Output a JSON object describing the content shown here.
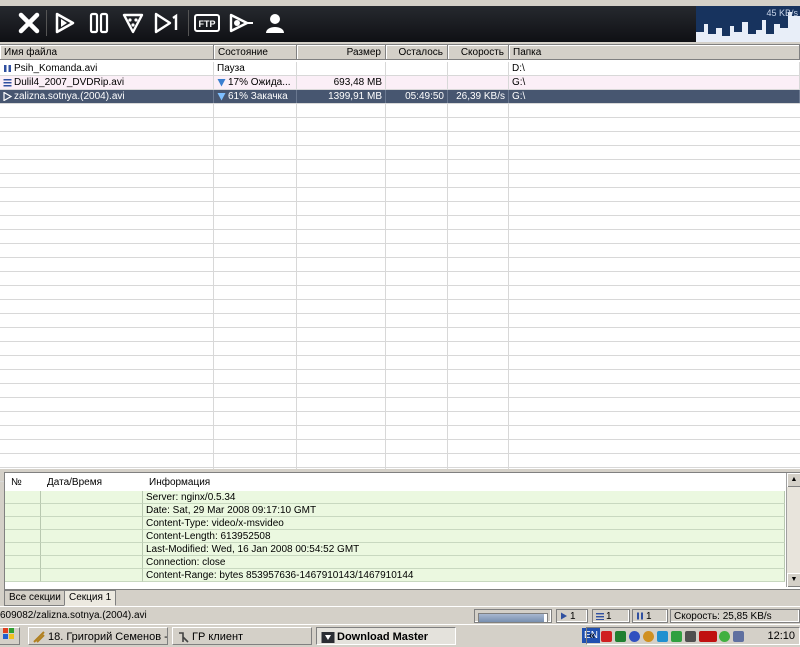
{
  "toolbar": {
    "buttons": [
      {
        "name": "delete",
        "icon": "close-icon"
      },
      {
        "name": "start",
        "icon": "play-icon"
      },
      {
        "name": "pause",
        "icon": "pause-icon"
      },
      {
        "name": "start-all",
        "icon": "start-all-icon"
      },
      {
        "name": "start-one",
        "icon": "play-one-icon"
      },
      {
        "name": "ftp",
        "icon": "ftp-icon",
        "label": "FTP"
      },
      {
        "name": "scheduler",
        "icon": "scheduler-icon"
      },
      {
        "name": "user",
        "icon": "user-icon"
      }
    ],
    "speed_graph_label": "45 KB/s"
  },
  "list": {
    "columns": [
      "Имя файла",
      "Состояние",
      "Размер",
      "Осталось",
      "Скорость",
      "Папка"
    ],
    "rows": [
      {
        "name": "Psih_Komanda.avi",
        "status": "Пауза",
        "size": "",
        "left": "",
        "speed": "",
        "folder": "D:\\",
        "icon": "pause-icon"
      },
      {
        "name": "Dulil4_2007_DVDRip.avi",
        "status": "17% Ожида...",
        "size": "693,48 MB",
        "left": "",
        "speed": "",
        "folder": "G:\\",
        "icon": "queue-icon"
      },
      {
        "name": "zalizna.sotnya.(2004).avi",
        "status": "61% Закачка",
        "size": "1399,91 MB",
        "left": "05:49:50",
        "speed": "26,39 KB/s",
        "folder": "G:\\",
        "icon": "play-icon"
      }
    ]
  },
  "log": {
    "columns": [
      "№",
      "Дата/Время",
      "Информация"
    ],
    "lines": [
      "Server: nginx/0.5.34",
      "Date: Sat, 29 Mar 2008 09:17:10 GMT",
      "Content-Type: video/x-msvideo",
      "Content-Length: 613952508",
      "Last-Modified: Wed, 16 Jan 2008 00:54:52 GMT",
      "Connection: close",
      "Content-Range: bytes 853957636-1467910143/1467910144"
    ]
  },
  "tabs": [
    "Все секции",
    "Секция 1"
  ],
  "status": {
    "url": "609082/zalizna.sotnya.(2004).avi",
    "active_count": "1",
    "queued_count": "1",
    "paused_count": "1",
    "speed": "Скорость: 25,85 KB/s"
  },
  "taskbar": {
    "tasks": [
      "18. Григорий Семенов - ...",
      "ГР клиент",
      "Download Master"
    ],
    "lang": "EN",
    "clock": "12:10"
  },
  "colors": {
    "selection": "#475670",
    "pink_row": "#fbeff7",
    "log_row": "#ebf8e0",
    "toolbar": "#1a1c20"
  }
}
